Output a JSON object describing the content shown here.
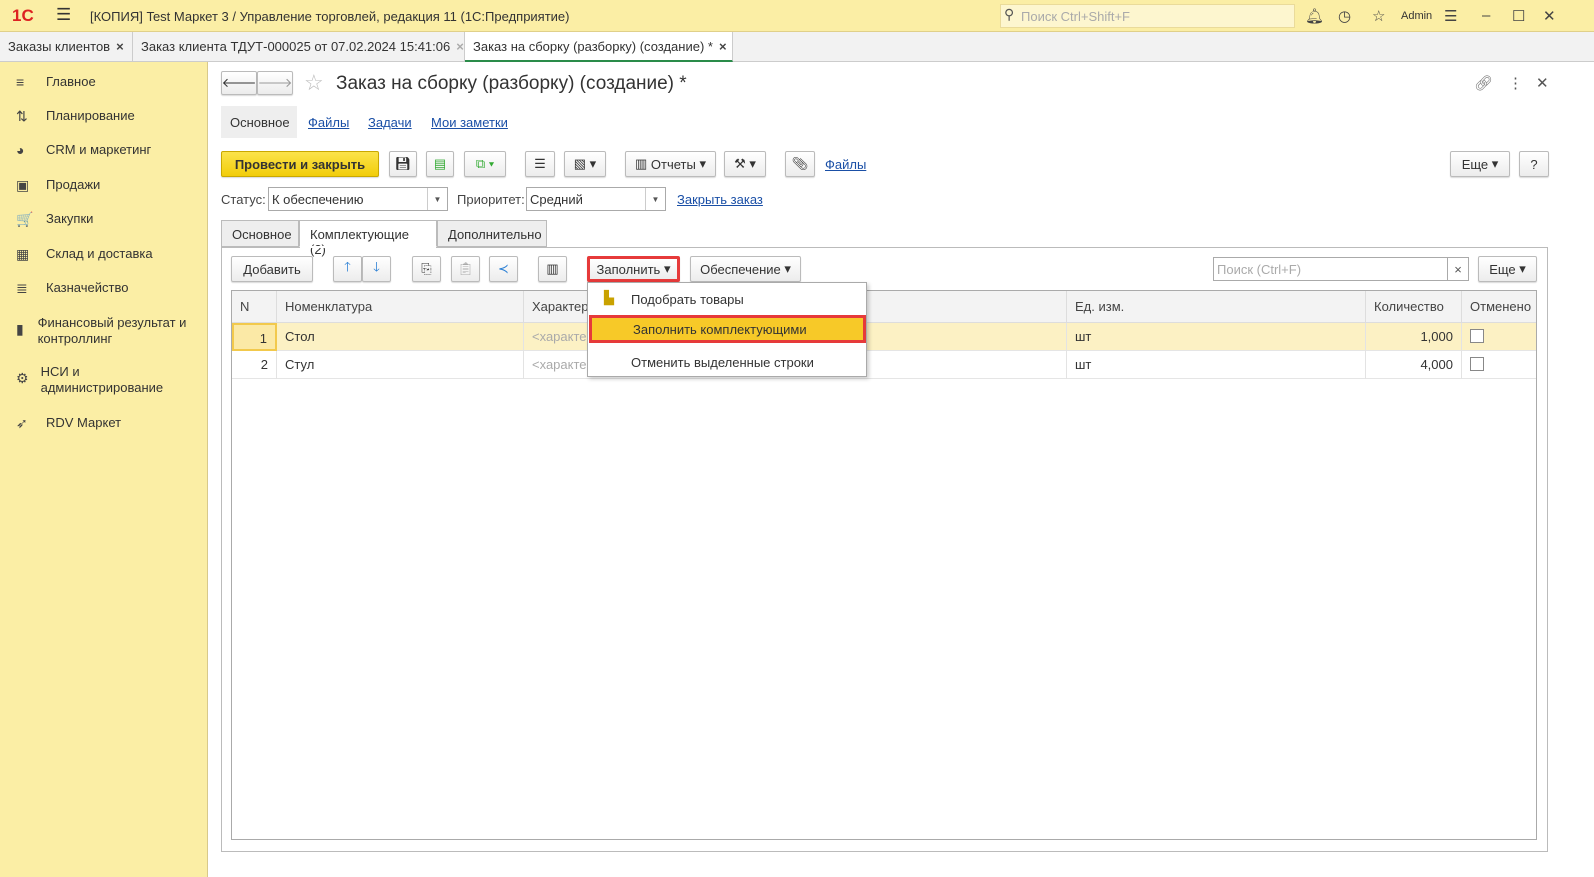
{
  "app": {
    "logo": "1С",
    "title": "[КОПИЯ] Test Маркет 3 / Управление торговлей, редакция 11  (1С:Предприятие)",
    "search_placeholder": "Поиск Ctrl+Shift+F",
    "user": "Admin"
  },
  "open_tabs": [
    {
      "label": "Заказы клиентов"
    },
    {
      "label": "Заказ клиента ТДУТ-000025 от 07.02.2024 15:41:06"
    },
    {
      "label": "Заказ на сборку (разборку) (создание) *"
    }
  ],
  "sidebar": {
    "items": [
      {
        "label": "Главное",
        "icon": "≡"
      },
      {
        "label": "Планирование",
        "icon": "⇅"
      },
      {
        "label": "CRM и маркетинг",
        "icon": "◕"
      },
      {
        "label": "Продажи",
        "icon": "▣"
      },
      {
        "label": "Закупки",
        "icon": "🛒"
      },
      {
        "label": "Склад и доставка",
        "icon": "▦"
      },
      {
        "label": "Казначейство",
        "icon": "≣"
      },
      {
        "label": "Финансовый результат и контроллинг",
        "icon": "▮"
      },
      {
        "label": "НСИ и администрирование",
        "icon": "⚙"
      },
      {
        "label": "RDV Маркет",
        "icon": "➶"
      }
    ]
  },
  "form": {
    "title": "Заказ на сборку (разборку) (создание) *",
    "nav": [
      "Основное",
      "Файлы",
      "Задачи",
      "Мои заметки"
    ],
    "post_close": "Провести и закрыть",
    "reports": "Отчеты",
    "files": "Файлы",
    "more": "Еще",
    "help": "?",
    "status_label": "Статус:",
    "status_value": "К обеспечению",
    "priority_label": "Приоритет:",
    "priority_value": "Средний",
    "close_order": "Закрыть заказ",
    "tabs": [
      "Основное",
      "Комплектующие (2)",
      "Дополнительно"
    ],
    "add": "Добавить",
    "fill": "Заполнить",
    "supply": "Обеспечение",
    "table_search_placeholder": "Поиск (Ctrl+F)",
    "table_more": "Еще",
    "clear": "×"
  },
  "menu": {
    "items": [
      "Подобрать товары",
      "Заполнить комплектующими",
      "Отменить выделенные строки"
    ]
  },
  "table": {
    "columns": [
      "N",
      "Номенклатура",
      "Характеристика",
      "Ед. изм.",
      "Количество",
      "Отменено"
    ],
    "rows": [
      {
        "n": "1",
        "item": "Стол",
        "char": "<характеристики не используются>",
        "unit": "шт",
        "qty": "1,000",
        "cancelled": false
      },
      {
        "n": "2",
        "item": "Стул",
        "char": "<характеристики не используются>",
        "unit": "шт",
        "qty": "4,000",
        "cancelled": false
      }
    ]
  },
  "colors": {
    "accent": "#f7d21a",
    "highlight": "#e63a3a",
    "sidebar": "#fbeea5"
  }
}
